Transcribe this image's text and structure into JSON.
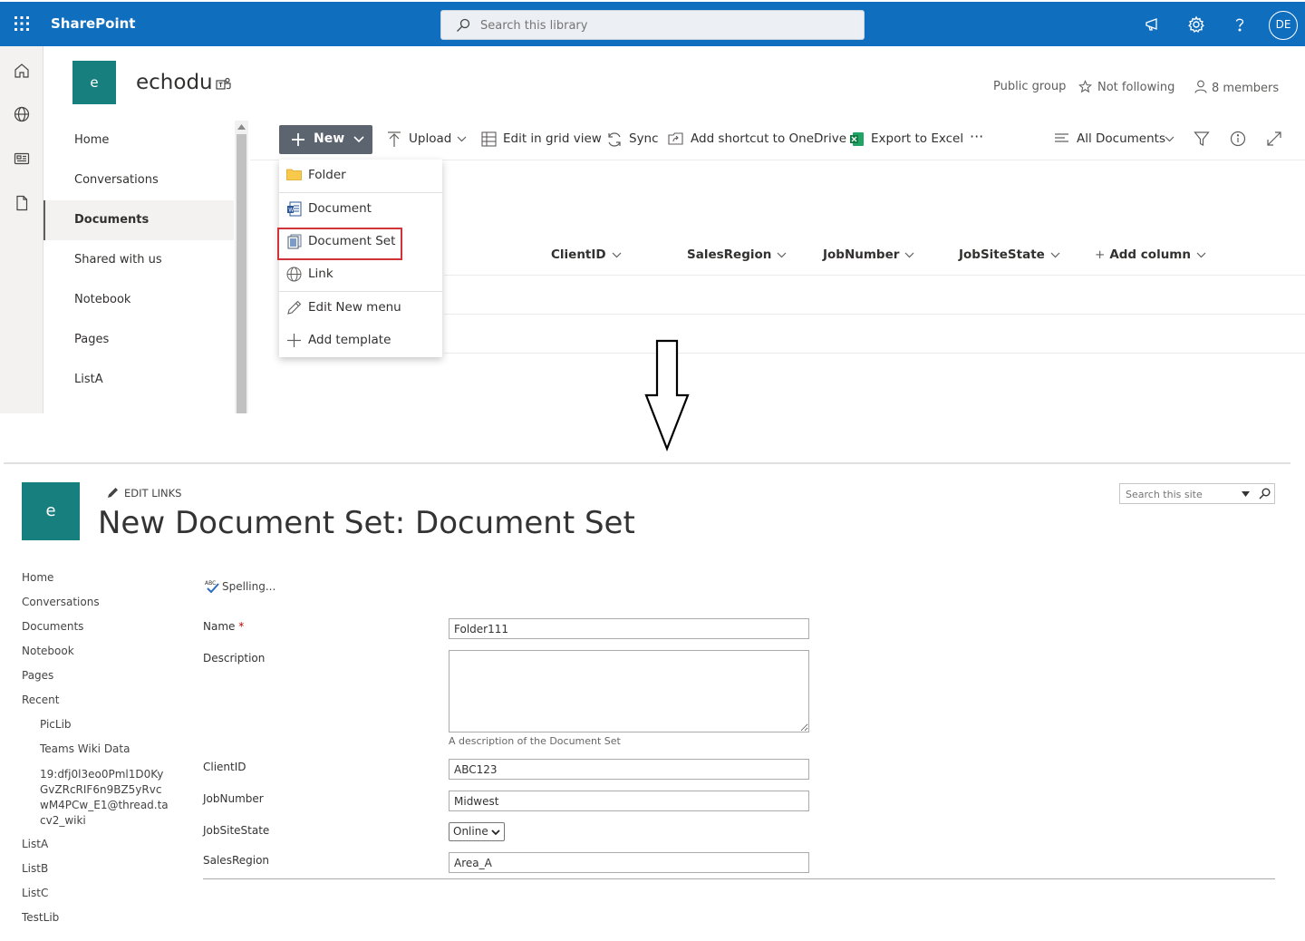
{
  "suite": {
    "brand": "SharePoint",
    "search_placeholder": "Search this library",
    "avatar_initials": "DE",
    "accent": "#106ebe"
  },
  "site": {
    "logo_letter": "e",
    "name": "echodu",
    "public_group": "Public group",
    "not_following": "Not following",
    "members": "8 members",
    "logo_color": "#17807e"
  },
  "leftnav": {
    "items": [
      "Home",
      "Conversations",
      "Documents",
      "Shared with us",
      "Notebook",
      "Pages",
      "ListA"
    ],
    "selected": "Documents"
  },
  "commandbar": {
    "new": "New",
    "upload": "Upload",
    "edit_grid": "Edit in grid view",
    "sync": "Sync",
    "shortcut": "Add shortcut to OneDrive",
    "export": "Export to Excel",
    "more": "···",
    "view": "All Documents"
  },
  "new_menu": {
    "items": [
      "Folder",
      "Document",
      "Document Set",
      "Link",
      "Edit New menu",
      "Add template"
    ],
    "highlighted": "Document Set",
    "highlight_color": "#d13438"
  },
  "columns": [
    "ClientID",
    "SalesRegion",
    "JobNumber",
    "JobSiteState",
    "Add column"
  ],
  "classic": {
    "logo_letter": "e",
    "edit_links": "EDIT LINKS",
    "title": "New Document Set: Document Set",
    "search_placeholder": "Search this site",
    "nav": [
      "Home",
      "Conversations",
      "Documents",
      "Notebook",
      "Pages",
      "Recent"
    ],
    "recent": [
      "PicLib",
      "Teams Wiki Data",
      "19:dfj0l3eo0Pml1D0KyGvZRcRIF6n9BZ5yRvcwM4PCw_E1@thread.tacv2_wiki"
    ],
    "nav_after": [
      "ListA",
      "ListB",
      "ListC",
      "TestLib"
    ],
    "spelling": "Spelling...",
    "form": {
      "name_label": "Name",
      "required_mark": "*",
      "name_value": "Folder111",
      "description_label": "Description",
      "description_value": "",
      "description_hint": "A description of the Document Set",
      "clientid_label": "ClientID",
      "clientid_value": "ABC123",
      "jobnumber_label": "JobNumber",
      "jobnumber_value": "Midwest",
      "jobsitestate_label": "JobSiteState",
      "jobsitestate_value": "Online",
      "salesregion_label": "SalesRegion",
      "salesregion_value": "Area_A"
    }
  }
}
